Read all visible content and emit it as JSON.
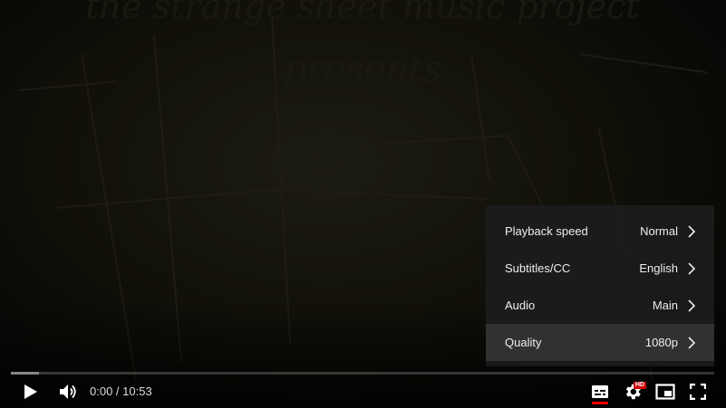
{
  "video": {
    "background_text_line1": "the strange sheet music project",
    "background_text_line2": "presents"
  },
  "settings_menu": {
    "items": [
      {
        "label": "Playback speed",
        "value": "Normal",
        "active": false
      },
      {
        "label": "Subtitles/CC",
        "value": "English",
        "active": false
      },
      {
        "label": "Audio",
        "value": "Main",
        "active": false
      },
      {
        "label": "Quality",
        "value": "1080p",
        "active": true
      }
    ]
  },
  "player": {
    "time_display": "0:00 / 10:53",
    "current_time": "0:00",
    "duration": "10:53",
    "progress_fraction": 0,
    "buffered_fraction": 0.04,
    "hd_badge": "HD",
    "icons": {
      "play": "play-icon",
      "volume": "volume-icon",
      "subtitles": "subtitles-icon",
      "settings": "gear-icon",
      "miniplayer": "miniplayer-icon",
      "fullscreen": "fullscreen-icon"
    },
    "colors": {
      "accent": "#ff0000",
      "menu_bg": "#1c1c1c",
      "text": "#eeeeee"
    }
  }
}
